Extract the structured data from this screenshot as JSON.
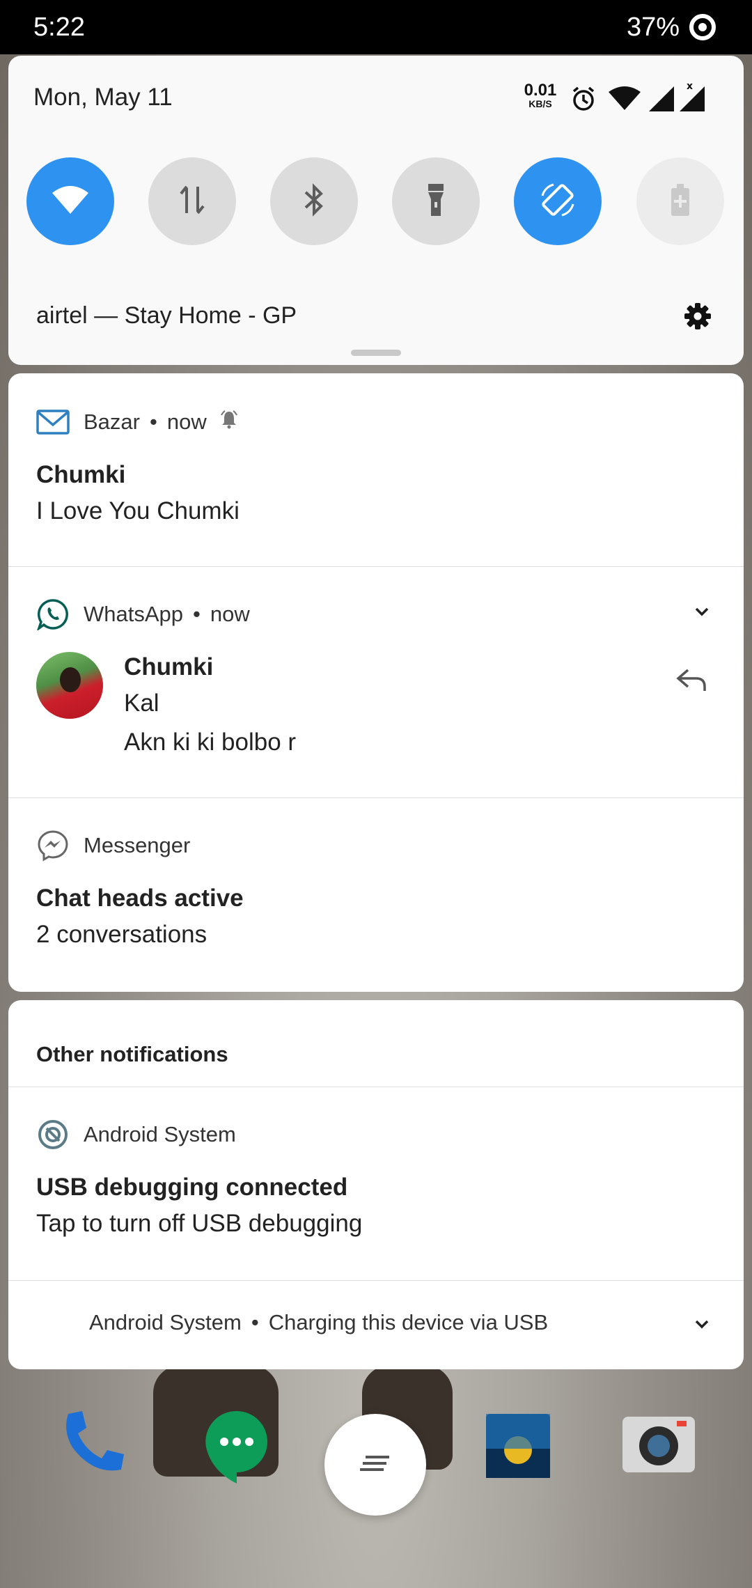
{
  "status_bar": {
    "time": "5:22",
    "battery": "37%"
  },
  "quick_settings": {
    "date": "Mon, May 11",
    "net_speed_value": "0.01",
    "net_speed_unit": "KB/S",
    "tiles": [
      {
        "name": "wifi",
        "state": "on"
      },
      {
        "name": "mobile-data",
        "state": "off"
      },
      {
        "name": "bluetooth",
        "state": "off"
      },
      {
        "name": "flashlight",
        "state": "off"
      },
      {
        "name": "auto-rotate",
        "state": "on"
      },
      {
        "name": "battery-saver",
        "state": "disabled"
      }
    ],
    "carrier": "airtel — Stay Home - GP"
  },
  "notifications": [
    {
      "app": "Bazar",
      "time": "now",
      "title": "Chumki",
      "body": "I Love You Chumki"
    },
    {
      "app": "WhatsApp",
      "time": "now",
      "title": "Chumki",
      "lines": [
        "Kal",
        "Akn ki ki bolbo r"
      ]
    },
    {
      "app": "Messenger",
      "title": "Chat heads active",
      "body": "2 conversations"
    }
  ],
  "other": {
    "header": "Other notifications",
    "items": [
      {
        "app": "Android System",
        "title": "USB debugging connected",
        "body": "Tap to turn off USB debugging"
      },
      {
        "app": "Android System",
        "summary": "Charging this device via USB"
      }
    ]
  },
  "separator_dot": "•",
  "colors": {
    "accent": "#2e93f0",
    "whatsapp": "#075e54",
    "bazar_mail": "#2f80c0"
  }
}
